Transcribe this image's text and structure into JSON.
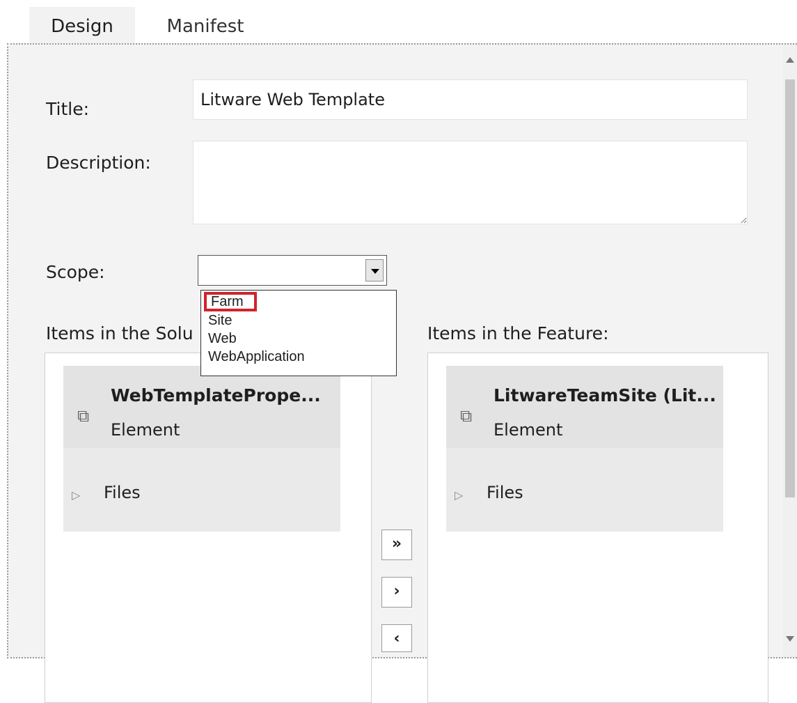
{
  "tabs": [
    {
      "label": "Design"
    },
    {
      "label": "Manifest"
    }
  ],
  "form": {
    "title_label": "Title:",
    "title_value": "Litware Web Template",
    "description_label": "Description:",
    "description_value": "",
    "scope_label": "Scope:",
    "scope_value": "",
    "scope_options": [
      "Farm",
      "Site",
      "Web",
      "WebApplication"
    ],
    "highlighted_option": "Farm"
  },
  "solution": {
    "label": "Items in the Solu",
    "item_name": "WebTemplatePrope...",
    "item_type": "Element",
    "files_label": "Files"
  },
  "feature": {
    "label": "Items in the Feature:",
    "item_name": "LitwareTeamSite (Lit...",
    "item_type": "Element",
    "files_label": "Files"
  },
  "buttons": {
    "add_all": "»",
    "add": "›",
    "remove": "‹"
  },
  "colors": {
    "highlight_border": "#d1232a"
  }
}
